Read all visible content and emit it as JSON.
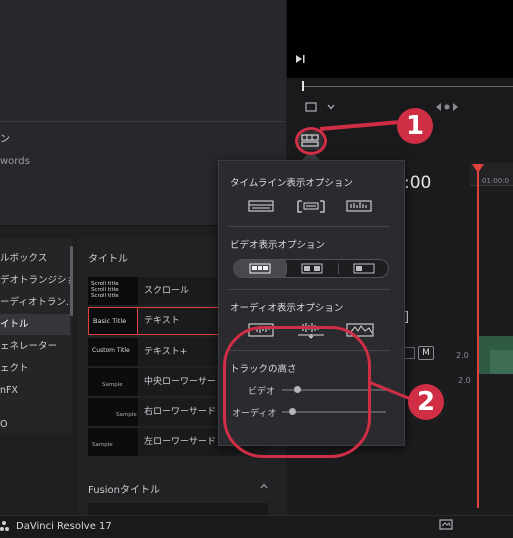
{
  "app": {
    "name": "DaVinci Resolve 17"
  },
  "top_panel": {
    "items": [
      {
        "label": "ン"
      },
      {
        "label": "words"
      }
    ]
  },
  "effects_list": {
    "items": [
      {
        "label": "ルボックス",
        "selected": false
      },
      {
        "label": "デオトランジション",
        "selected": false
      },
      {
        "label": "ーディオトラン...",
        "selected": false
      },
      {
        "label": "イトル",
        "selected": true
      },
      {
        "label": "ェネレーター",
        "selected": false
      },
      {
        "label": "ェクト",
        "selected": false
      },
      {
        "label": "nFX",
        "selected": false
      },
      {
        "label": "O",
        "selected": false
      }
    ]
  },
  "title_browser": {
    "header": "タイトル",
    "items": [
      {
        "thumb": "Scroll title\nScroll title\nScroll title",
        "label": "スクロール",
        "selected": false
      },
      {
        "thumb": "Basic Title",
        "label": "テキスト",
        "selected": true
      },
      {
        "thumb": "Custom Title",
        "label": "テキスト+",
        "selected": false
      },
      {
        "thumb": "Sample",
        "label": "中央ローワーサード",
        "selected": false
      },
      {
        "thumb": "Sample",
        "label": "右ローワーサード",
        "selected": false
      },
      {
        "thumb": "Sample",
        "label": "左ローワーサード",
        "selected": false
      }
    ],
    "fusion_header": "Fusionタイトル"
  },
  "timeline": {
    "timecode": ":00",
    "ruler_label": "01:00:0",
    "track_buttons": [
      "M"
    ],
    "track_values": [
      "2.0",
      "2.0"
    ],
    "bracket": "]"
  },
  "popup": {
    "timeline_view": {
      "title": "タイムライン表示オプション",
      "icons": [
        "film-strip-icon",
        "stacked-timeline-icon",
        "audio-waveform-view-icon"
      ]
    },
    "video_view": {
      "title": "ビデオ表示オプション",
      "icons": [
        "video-thumbs-filmstrip-icon",
        "video-thumbs-ends-icon",
        "video-thumbs-none-icon"
      ],
      "selected_index": 0
    },
    "audio_view": {
      "title": "オーディオ表示オプション",
      "icons": [
        "audio-waveform-icon",
        "audio-waveform-full-icon",
        "audio-waveform-overlay-icon"
      ]
    },
    "track_height": {
      "title": "トラックの高さ",
      "video_label": "ビデオ",
      "audio_label": "オーディオ",
      "video_level": 0.14,
      "audio_level": 0.1
    }
  },
  "annotations": {
    "badge1": "1",
    "badge2": "2"
  },
  "colors": {
    "accent_red": "#e0413a",
    "annotation_red": "#cf2e45",
    "panel": "#2b2b2f"
  }
}
